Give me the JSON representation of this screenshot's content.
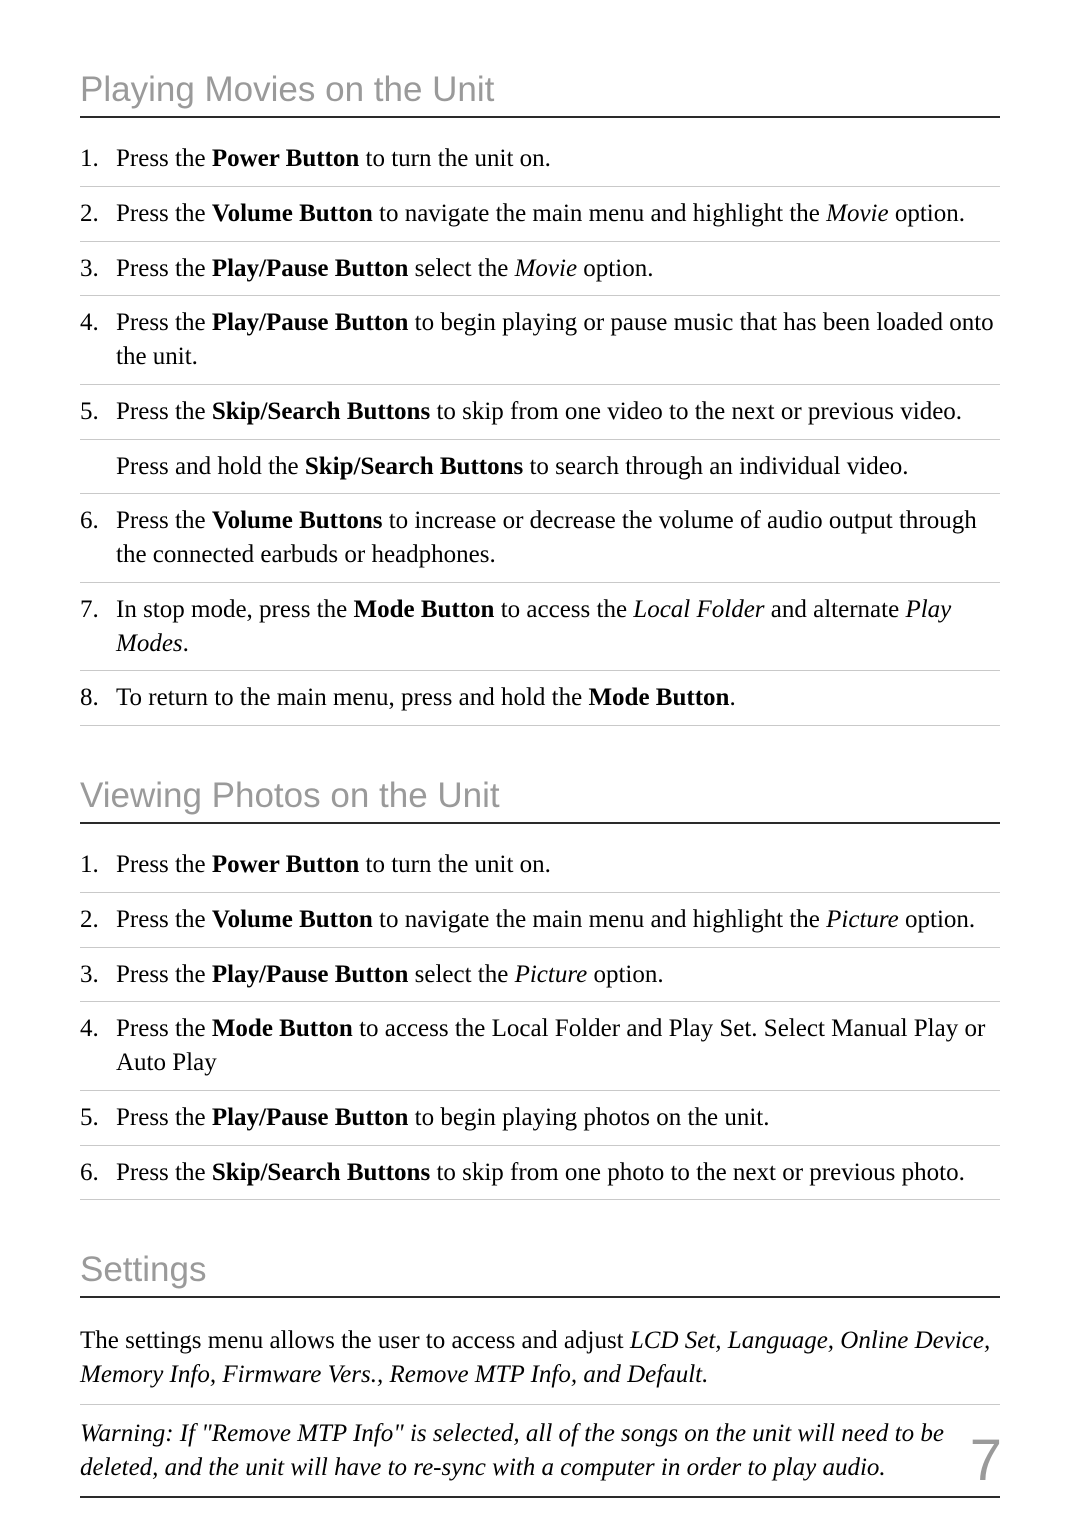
{
  "page_number": "7",
  "sections": {
    "movies": {
      "heading": "Playing Movies on the Unit",
      "items": [
        {
          "pre": "Press the ",
          "bold": "Power Button",
          "post": " to turn the unit on."
        },
        {
          "pre": "Press the ",
          "bold": "Volume Button",
          "mid": " to navigate the main menu and highlight the ",
          "ital": "Movie",
          "post2": " option."
        },
        {
          "pre": "Press the ",
          "bold": "Play/Pause Button",
          "mid": " select the ",
          "ital": "Movie",
          "post2": " option."
        },
        {
          "pre": "Press the ",
          "bold": "Play/Pause Button",
          "post": " to begin playing or pause music that has been loaded onto the unit."
        },
        {
          "pre": "Press the ",
          "bold": "Skip/Search Buttons",
          "post": " to skip from one video to the next or previous video.",
          "sub_pre": "Press and hold the ",
          "sub_bold": "Skip/Search Buttons",
          "sub_post": " to search through an individual video."
        },
        {
          "pre": "Press the ",
          "bold": "Volume Buttons",
          "post": " to increase or decrease the volume of audio output through the connected earbuds or headphones."
        },
        {
          "pre": "In stop mode, press the ",
          "bold": "Mode Button",
          "mid": " to access the ",
          "ital": "Local Folder",
          "mid2": " and alternate ",
          "ital2": "Play Modes",
          "post2": "."
        },
        {
          "pre": "To return to the main menu, press and hold the ",
          "bold": "Mode Button",
          "post": "."
        }
      ]
    },
    "photos": {
      "heading": "Viewing Photos on the Unit",
      "items": [
        {
          "pre": "Press the ",
          "bold": "Power Button",
          "post": " to turn the unit on."
        },
        {
          "pre": "Press the ",
          "bold": "Volume Button",
          "mid": " to navigate the main menu and highlight the ",
          "ital": "Picture",
          "post2": " option."
        },
        {
          "pre": "Press the ",
          "bold": "Play/Pause Button",
          "mid": " select the ",
          "ital": "Picture",
          "post2": " option."
        },
        {
          "pre": "Press the ",
          "bold": "Mode Button",
          "post": " to access the Local Folder and Play Set.  Select Manual Play or Auto Play"
        },
        {
          "pre": "Press the ",
          "bold": "Play/Pause Button",
          "post": " to begin playing photos on the unit."
        },
        {
          "pre": "Press the ",
          "bold": "Skip/Search Buttons",
          "post": " to skip from one photo to the next or previous photo."
        }
      ]
    },
    "settings": {
      "heading": "Settings",
      "intro_pre": "The settings menu allows the user to access and adjust ",
      "intro_ital": "LCD Set, Language, Online Device, Memory Info, Firmware Vers., Remove MTP Info, and Default.",
      "warning": "Warning:  If \"Remove MTP Info\" is selected, all of the songs on the unit will need to be deleted, and the unit will have to re-sync with a computer in order to play audio."
    }
  }
}
